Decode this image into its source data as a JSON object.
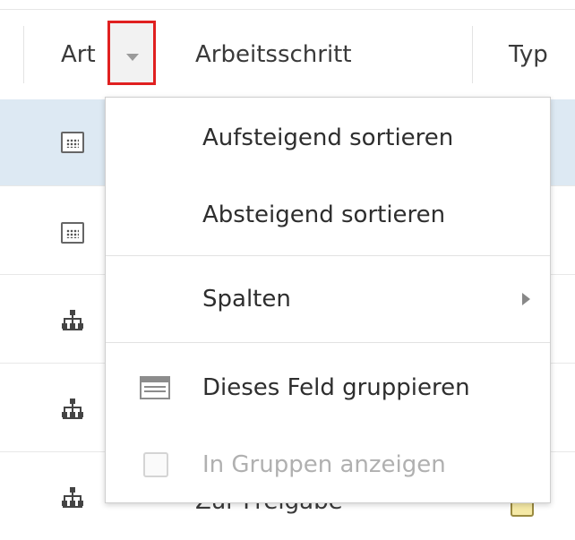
{
  "columns": {
    "art": "Art",
    "arbeitsschritt": "Arbeitsschritt",
    "typ": "Typ"
  },
  "rows": [
    {
      "icon": "calendar-icon",
      "selected": true
    },
    {
      "icon": "calendar-icon",
      "selected": false
    },
    {
      "icon": "workflow-icon",
      "selected": false
    },
    {
      "icon": "workflow-icon",
      "selected": false
    },
    {
      "icon": "workflow-icon",
      "selected": false,
      "text": "Zur Freigabe"
    }
  ],
  "menu": {
    "sort_asc": "Aufsteigend sortieren",
    "sort_desc": "Absteigend sortieren",
    "columns": "Spalten",
    "group_by": "Dieses Feld gruppieren",
    "show_in_groups": "In Gruppen anzeigen"
  },
  "colors": {
    "highlight_border": "#e02020",
    "selected_row": "#dde9f3"
  }
}
